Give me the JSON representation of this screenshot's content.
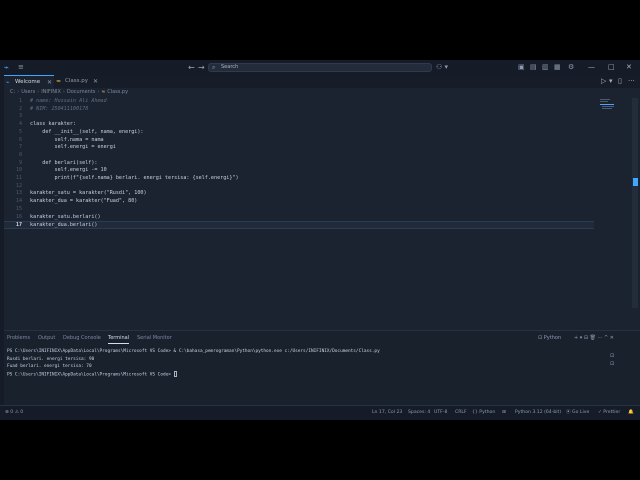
{
  "titlebar": {
    "logo": "⌁",
    "menu": "≡",
    "back": "←",
    "forward": "→",
    "search_placeholder": "Search",
    "copilot": "⚇ ▾",
    "layout_icons": [
      "▣",
      "▤",
      "▥",
      "▦"
    ],
    "settings": "⚙",
    "minimize": "—",
    "maximize": "□",
    "close": "✕"
  },
  "tabs": [
    {
      "label": "Welcome",
      "icon": "⌁",
      "active": true,
      "close": "✕"
    },
    {
      "label": "Class.py",
      "icon": "≈",
      "active": false,
      "close": "✕"
    }
  ],
  "editor_actions": {
    "run": "▷",
    "run_menu": "▾",
    "split": "▯",
    "more": "···"
  },
  "breadcrumb": [
    "C:",
    "Users",
    "INIFINIX",
    "Documents",
    "Class.py"
  ],
  "breadcrumb_sep": "›",
  "code_lines": [
    {
      "n": "1",
      "text": "# name: Hussain Ali Ahmad",
      "kind": "comment"
    },
    {
      "n": "2",
      "text": "# NIM: 250411100178",
      "kind": "comment"
    },
    {
      "n": "3",
      "text": "",
      "kind": "plain"
    },
    {
      "n": "4",
      "text": "class karakter:",
      "kind": "plain"
    },
    {
      "n": "5",
      "text": "    def __init__(self, nama, energi):",
      "kind": "plain"
    },
    {
      "n": "6",
      "text": "        self.nama = nama",
      "kind": "plain"
    },
    {
      "n": "7",
      "text": "        self.energi = energi",
      "kind": "plain"
    },
    {
      "n": "8",
      "text": "",
      "kind": "plain"
    },
    {
      "n": "9",
      "text": "    def berlari(self):",
      "kind": "plain"
    },
    {
      "n": "10",
      "text": "        self.energi -= 10",
      "kind": "plain"
    },
    {
      "n": "11",
      "text": "        print(f\"{self.nama} berlari. energi tersisa: {self.energi}\")",
      "kind": "plain"
    },
    {
      "n": "12",
      "text": "",
      "kind": "plain"
    },
    {
      "n": "13",
      "text": "karakter_satu = karakter(\"Rusdi\", 100)",
      "kind": "plain"
    },
    {
      "n": "14",
      "text": "karakter_dua = karakter(\"Fuad\", 80)",
      "kind": "plain"
    },
    {
      "n": "15",
      "text": "",
      "kind": "plain"
    },
    {
      "n": "16",
      "text": "karakter_satu.berlari()",
      "kind": "plain"
    },
    {
      "n": "17",
      "text": "karakter_dua.berlari()",
      "kind": "plain"
    }
  ],
  "current_line": "17",
  "panel": {
    "tabs": [
      "Problems",
      "Output",
      "Debug Console",
      "Terminal",
      "Serial Monitor"
    ],
    "active_tab": "Terminal",
    "shell": "⊡ Python",
    "actions": "+ ▾ ⊟ 🗑 ··· ^ ✕",
    "terminal_lines": [
      "PS C:\\Users\\INIFINIX\\AppData\\Local\\Programs\\Microsoft VS Code> & C:\\bahasa_pemrograman\\Python\\python.exe c:/Users/INIFINIX/Documents/Class.py",
      "Rusdi berlari. energi tersisa: 90",
      "Fuad berlari. energi tersisa: 70",
      "PS C:\\Users\\INIFINIX\\AppData\\Local\\Programs\\Microsoft VS Code> "
    ]
  },
  "status": {
    "remote": "⊗ 0 ⚠ 0",
    "position": "Ln 17, Col 23",
    "spaces": "Spaces: 4",
    "encoding": "UTF-8",
    "eol": "CRLF",
    "language": "{} Python",
    "indicator": "⊞",
    "interpreter": "Python 3.12 (64-bit)",
    "golive": "⦿ Go Live",
    "prettier": "✓ Prettier",
    "bell": "🔔"
  },
  "colors": {
    "accent": "#3fa7ff",
    "background": "#1b2330"
  }
}
